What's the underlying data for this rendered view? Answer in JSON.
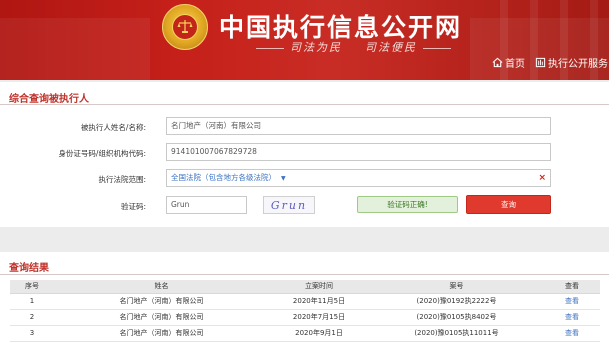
{
  "header": {
    "site_title": "中国执行信息公开网",
    "slogan_left": "司法为民",
    "slogan_right": "司法便民",
    "nav": [
      {
        "label": "首页",
        "icon": "home-icon"
      },
      {
        "label": "执行公开服务",
        "icon": "service-icon"
      }
    ],
    "colors": {
      "brand_red": "#c6201a",
      "gold": "#e0a722"
    }
  },
  "query": {
    "title": "综合查询被执行人",
    "name_label": "被执行人姓名/名称:",
    "name_value": "名门地产（河南）有限公司",
    "id_label": "身份证号码/组织机构代码:",
    "id_value": "914101007067829728",
    "court_label": "执行法院范围:",
    "court_value": "全国法院（包含地方各级法院）",
    "captcha_label": "验证码:",
    "captcha_value": "Grun",
    "captcha_image_text": "Grun",
    "captcha_ok": "验证码正确!",
    "search_button": "查询",
    "colors": {
      "accent": "#c0322b",
      "button": "#e03a2e",
      "link": "#3a72c4",
      "success": "#3c7a25"
    }
  },
  "results": {
    "title": "查询结果",
    "columns": [
      "序号",
      "姓名",
      "立案时间",
      "案号",
      "查看"
    ],
    "rows": [
      {
        "no": "1",
        "name": "名门地产（河南）有限公司",
        "date": "2020年11月5日",
        "case": "(2020)豫0192执2222号",
        "view": "查看"
      },
      {
        "no": "2",
        "name": "名门地产（河南）有限公司",
        "date": "2020年7月15日",
        "case": "(2020)豫0105执8402号",
        "view": "查看"
      },
      {
        "no": "3",
        "name": "名门地产（河南）有限公司",
        "date": "2020年9月1日",
        "case": "(2020)豫0105执11011号",
        "view": "查看"
      }
    ]
  }
}
